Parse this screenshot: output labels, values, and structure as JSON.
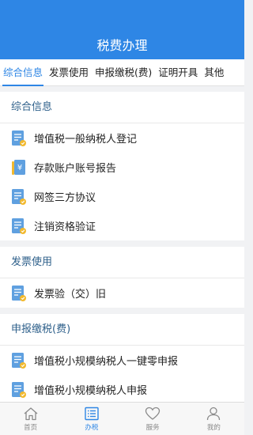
{
  "header": {
    "title": "税费办理"
  },
  "tabs": [
    {
      "label": "综合信息",
      "active": true
    },
    {
      "label": "发票使用",
      "active": false
    },
    {
      "label": "申报缴税(费)",
      "active": false
    },
    {
      "label": "证明开具",
      "active": false
    },
    {
      "label": "其他",
      "active": false
    }
  ],
  "sections": [
    {
      "title": "综合信息",
      "items": [
        {
          "label": "增值税一般纳税人登记",
          "icon": "document-icon"
        },
        {
          "label": "存款账户账号报告",
          "icon": "yuan-document-icon"
        },
        {
          "label": "网签三方协议",
          "icon": "document-icon"
        },
        {
          "label": "注销资格验证",
          "icon": "document-icon"
        }
      ]
    },
    {
      "title": "发票使用",
      "items": [
        {
          "label": "发票验（交）旧",
          "icon": "document-icon"
        }
      ]
    },
    {
      "title": "申报缴税(费)",
      "items": [
        {
          "label": "增值税小规模纳税人一键零申报",
          "icon": "document-icon"
        },
        {
          "label": "增值税小规模纳税人申报",
          "icon": "document-icon"
        }
      ]
    }
  ],
  "bottom_nav": [
    {
      "label": "首页",
      "icon": "home-icon",
      "active": false
    },
    {
      "label": "办税",
      "icon": "list-icon",
      "active": true
    },
    {
      "label": "服务",
      "icon": "heart-icon",
      "active": false
    },
    {
      "label": "我的",
      "icon": "user-icon",
      "active": false
    }
  ],
  "colors": {
    "primary": "#2e86e5",
    "section_title": "#2d5f8a",
    "icon_badge": "#f2b92e"
  }
}
